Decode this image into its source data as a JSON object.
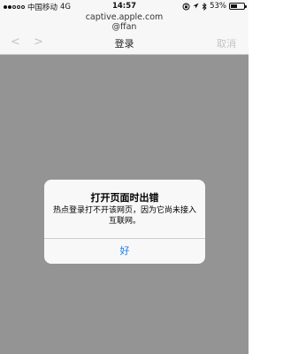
{
  "status_bar": {
    "carrier": "中国移动",
    "network": "4G",
    "time": "14:57",
    "battery_percent": "53%",
    "battery_level": 0.53,
    "signal_bars_filled": 2,
    "signal_bars_total": 5,
    "icons": [
      "signal-dots",
      "lock-rotation-icon",
      "location-icon",
      "bluetooth-icon",
      "battery-icon"
    ]
  },
  "header": {
    "url": "captive.apple.com",
    "ssid": "@ffan",
    "title": "登录",
    "cancel_label": "取消",
    "back_glyph": "<",
    "forward_glyph": ">"
  },
  "alert": {
    "title": "打开页面时出错",
    "message": "热点登录打不开该网页，因为它尚未接入互联网。",
    "ok_label": "好"
  },
  "colors": {
    "accent": "#1a7cf5",
    "disabled": "#c4c4c8",
    "overlay": "rgba(0,0,0,0.4)"
  }
}
